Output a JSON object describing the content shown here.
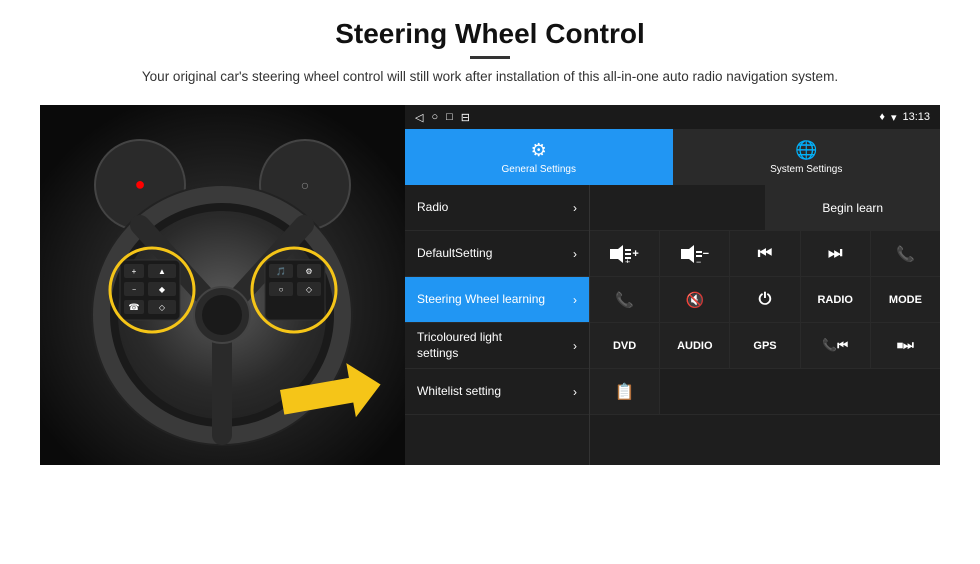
{
  "header": {
    "title": "Steering Wheel Control",
    "subtitle": "Your original car's steering wheel control will still work after installation of this all-in-one auto radio navigation system."
  },
  "tabs": [
    {
      "label": "General Settings",
      "icon": "⚙",
      "active": true
    },
    {
      "label": "System Settings",
      "icon": "🌐",
      "active": false
    }
  ],
  "status_bar": {
    "time": "13:13",
    "nav_icons": [
      "◁",
      "○",
      "□",
      "⊟"
    ]
  },
  "menu_items": [
    {
      "label": "Radio",
      "active": false
    },
    {
      "label": "DefaultSetting",
      "active": false
    },
    {
      "label": "Steering Wheel learning",
      "active": true
    },
    {
      "label": "Tricoloured light settings",
      "active": false
    },
    {
      "label": "Whitelist setting",
      "active": false
    }
  ],
  "grid": {
    "begin_learn_label": "Begin learn",
    "row1": [
      "",
      "Begin learn"
    ],
    "row2": [
      "🔊+",
      "🔉−",
      "⏮",
      "⏭",
      "📞"
    ],
    "row3": [
      "📞",
      "🔇",
      "⏻",
      "RADIO",
      "MODE"
    ],
    "row4": [
      "DVD",
      "AUDIO",
      "GPS",
      "📞⏮",
      "⏹⏭"
    ],
    "row5": [
      "📋"
    ]
  }
}
